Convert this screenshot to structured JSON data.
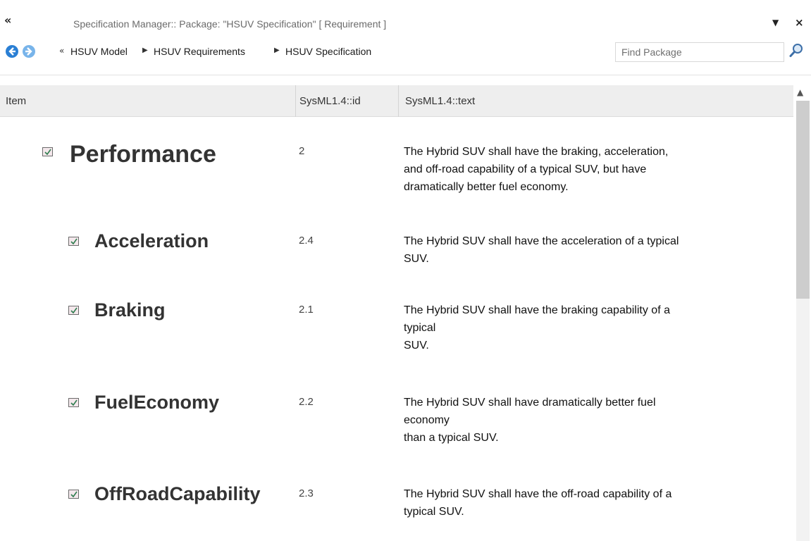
{
  "window": {
    "title": "Specification Manager::  Package: \"HSUV Specification\"  [ Requirement ]"
  },
  "nav": {
    "breadcrumb": [
      "HSUV Model",
      "HSUV Requirements",
      "HSUV Specification"
    ],
    "search_placeholder": "Find Package"
  },
  "table": {
    "columns": [
      "Item",
      "SysML1.4::id",
      "SysML1.4::text"
    ],
    "rows": [
      {
        "name": "Performance",
        "id": "2",
        "text": [
          "The Hybrid SUV shall have the braking, acceleration,",
          "and off-road capability of a typical SUV, but have",
          "dramatically better fuel economy."
        ]
      },
      {
        "name": "Acceleration",
        "id": "2.4",
        "text": [
          "The Hybrid SUV shall have the acceleration of a typical",
          "SUV."
        ]
      },
      {
        "name": "Braking",
        "id": "2.1",
        "text": [
          "The Hybrid SUV shall have the braking capability of a",
          "typical",
          "SUV."
        ]
      },
      {
        "name": "FuelEconomy",
        "id": "2.2",
        "text": [
          "The Hybrid SUV shall have dramatically better fuel",
          "economy",
          "than a typical SUV."
        ]
      },
      {
        "name": "OffRoadCapability",
        "id": "2.3",
        "text": [
          "The Hybrid SUV shall have the off-road capability of a",
          "typical SUV."
        ]
      }
    ]
  },
  "icons": {
    "collapse": "double-chevron-left-icon",
    "menu": "dropdown-arrow-icon",
    "close": "close-icon",
    "back": "back-arrow-icon",
    "forward": "forward-arrow-icon",
    "search": "magnifier-icon",
    "requirement": "requirement-icon"
  },
  "colors": {
    "nav_back": "#2a7fd4",
    "nav_forward": "#78b4ea",
    "header_bg": "#eeeeee",
    "requirement_icon": "#f4e8ec"
  }
}
